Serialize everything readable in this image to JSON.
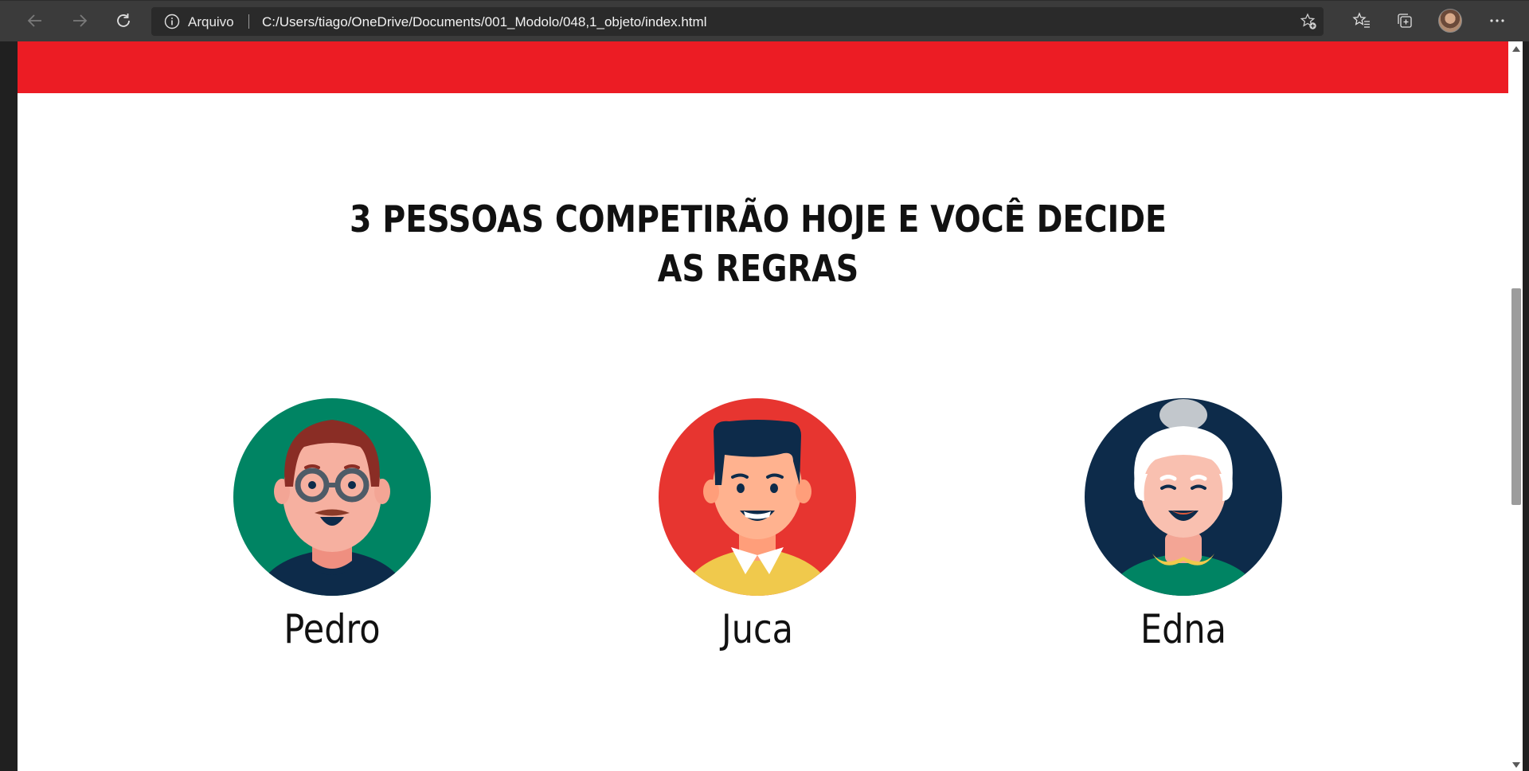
{
  "browser": {
    "address": {
      "protocol_label": "Arquivo",
      "url": "C:/Users/tiago/OneDrive/Documents/001_Modolo/048,1_objeto/index.html"
    },
    "icons": {
      "back": "arrow-left-icon",
      "forward": "arrow-right-icon",
      "refresh": "refresh-icon",
      "info": "info-icon",
      "add_favorite": "star-plus-icon",
      "favorites": "favorites-icon",
      "collections": "collections-icon",
      "more": "more-icon"
    }
  },
  "page": {
    "banner_color": "#ec1c24",
    "heading_line1": "3 PESSOAS COMPETIRÃO HOJE E VOCÊ DECIDE",
    "heading_line2": "AS REGRAS",
    "people": [
      {
        "name": "Pedro",
        "bg": "#008463"
      },
      {
        "name": "Juca",
        "bg": "#e73530"
      },
      {
        "name": "Edna",
        "bg": "#0d2b4a"
      }
    ]
  }
}
